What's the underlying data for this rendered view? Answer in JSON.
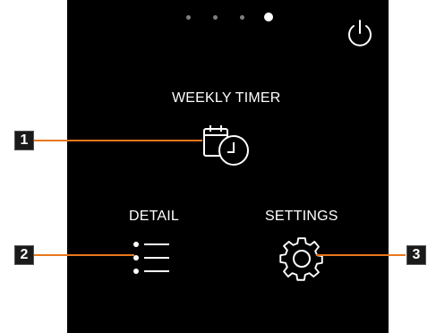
{
  "page_indicator": {
    "count": 4,
    "active_index": 3
  },
  "menu": {
    "weekly_timer_label": "WEEKLY TIMER",
    "detail_label": "DETAIL",
    "settings_label": "SETTINGS"
  },
  "icons": {
    "power": "power-icon",
    "weekly_timer": "calendar-clock-icon",
    "detail": "list-icon",
    "settings": "gear-icon"
  },
  "callouts": [
    "1",
    "2",
    "3"
  ],
  "colors": {
    "screen_bg": "#000000",
    "foreground": "#ffffff",
    "callout_line": "#e8771c",
    "dot_inactive": "#7f7f7f",
    "dot_active": "#ffffff"
  }
}
